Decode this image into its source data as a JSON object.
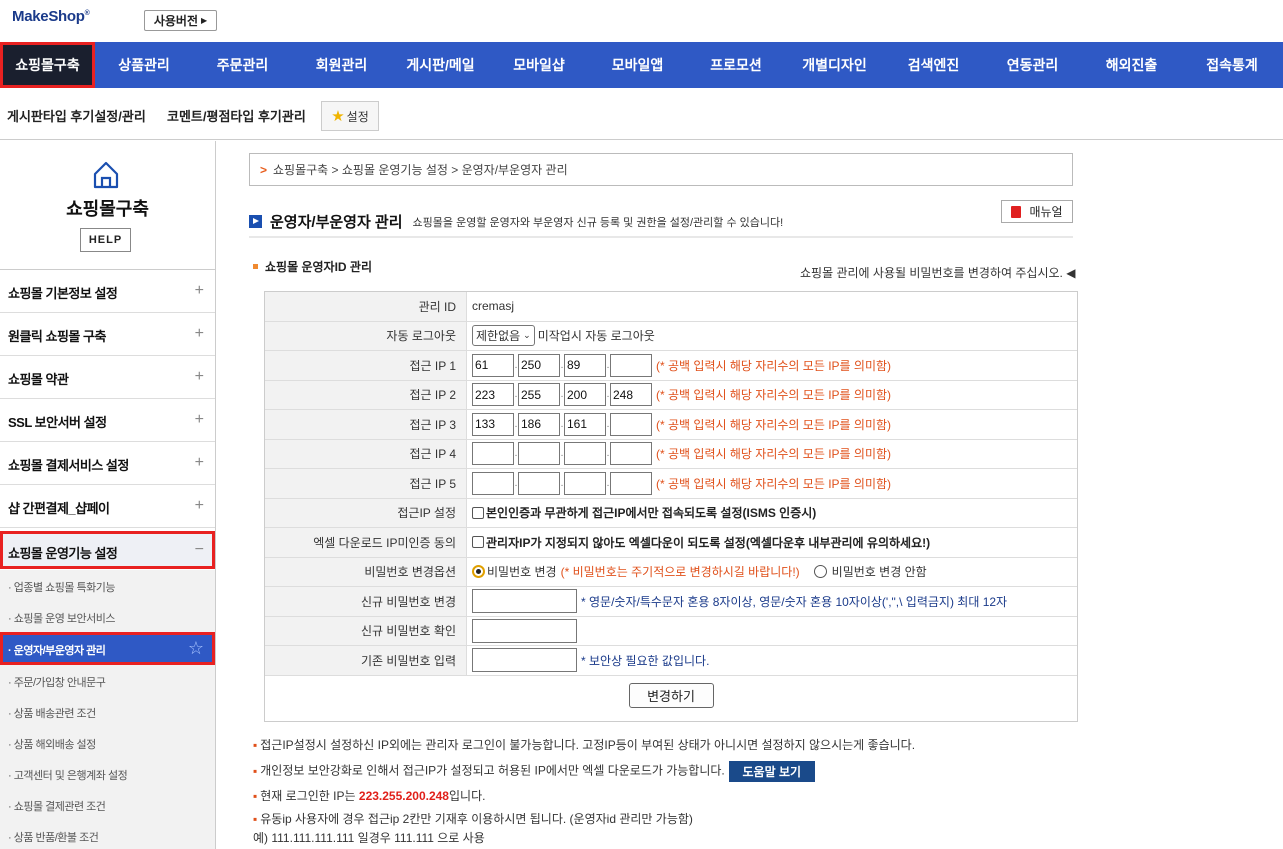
{
  "header": {
    "logo": "MakeShop",
    "logo_mark": "®",
    "version_label": "사용버전"
  },
  "main_nav": [
    {
      "label": "쇼핑몰구축",
      "active": true
    },
    {
      "label": "상품관리"
    },
    {
      "label": "주문관리"
    },
    {
      "label": "회원관리"
    },
    {
      "label": "게시판/메일"
    },
    {
      "label": "모바일샵"
    },
    {
      "label": "모바일앱"
    },
    {
      "label": "프로모션"
    },
    {
      "label": "개별디자인"
    },
    {
      "label": "검색엔진"
    },
    {
      "label": "연동관리"
    },
    {
      "label": "해외진출"
    },
    {
      "label": "접속통계"
    }
  ],
  "sub_nav": {
    "links": [
      "게시판타입 후기설정/관리",
      "코멘트/평점타입 후기관리"
    ],
    "fav_label": "설정"
  },
  "sidebar": {
    "title": "쇼핑몰구축",
    "help_label": "HELP",
    "menus": [
      {
        "label": "쇼핑몰 기본정보 설정",
        "icon": "+"
      },
      {
        "label": "원클릭 쇼핑몰 구축",
        "icon": "+"
      },
      {
        "label": "쇼핑몰 약관",
        "icon": "+"
      },
      {
        "label": "SSL 보안서버 설정",
        "icon": "+"
      },
      {
        "label": "쇼핑몰 결제서비스 설정",
        "icon": "+"
      },
      {
        "label": "샵 간편결제_샵페이",
        "icon": "+"
      },
      {
        "label": "쇼핑몰 운영기능 설정",
        "icon": "−",
        "open": true
      }
    ],
    "sub_items": [
      {
        "label": "· 업종별 쇼핑몰 특화기능"
      },
      {
        "label": "· 쇼핑몰 운영 보안서비스"
      },
      {
        "label": "· 운영자/부운영자 관리",
        "active": true
      },
      {
        "label": "· 주문/가입창 안내문구"
      },
      {
        "label": "· 상품 배송관련 조건"
      },
      {
        "label": "· 상품 해외배송 설정"
      },
      {
        "label": "· 고객센터 및 은행계좌 설정"
      },
      {
        "label": "· 쇼핑몰 결제관련 조건"
      },
      {
        "label": "· 상품 반품/환불 조건"
      }
    ]
  },
  "breadcrumb": "쇼핑몰구축 > 쇼핑몰 운영기능 설정 > 운영자/부운영자 관리",
  "page": {
    "title": "운영자/부운영자 관리",
    "description": "쇼핑몰을 운영할 운영자와 부운영자 신규 등록 및 권한을 설정/관리할 수 있습니다!",
    "manual_label": "매뉴얼",
    "section_title": "쇼핑몰 운영자ID 관리",
    "section_note": "쇼핑몰 관리에 사용될 비밀번호를 변경하여 주십시오. ◀"
  },
  "form": {
    "admin_id_label": "관리 ID",
    "admin_id_value": "cremasj",
    "auto_logout_label": "자동 로그아웃",
    "auto_logout_select": "제한없음",
    "auto_logout_note": "미작업시 자동 로그아웃",
    "ip_note": "(* 공백 입력시 해당 자리수의 모든 IP를 의미함)",
    "ip_rows": [
      {
        "label": "접근 IP 1",
        "values": [
          "61",
          "250",
          "89",
          ""
        ]
      },
      {
        "label": "접근 IP 2",
        "values": [
          "223",
          "255",
          "200",
          "248"
        ]
      },
      {
        "label": "접근 IP 3",
        "values": [
          "133",
          "186",
          "161",
          ""
        ]
      },
      {
        "label": "접근 IP 4",
        "values": [
          "",
          "",
          "",
          ""
        ]
      },
      {
        "label": "접근 IP 5",
        "values": [
          "",
          "",
          "",
          ""
        ]
      }
    ],
    "ip_setting_label": "접근IP 설정",
    "ip_setting_text": "본인인증과 무관하게 접근IP에서만 접속되도록 설정(ISMS 인증시)",
    "excel_label": "엑셀 다운로드 IP미인증 동의",
    "excel_text": "관리자IP가 지정되지 않아도 엑셀다운이 되도록 설정(엑셀다운후 내부관리에 유의하세요!)",
    "pw_option_label": "비밀번호 변경옵션",
    "pw_change_label": "비밀번호 변경",
    "pw_change_note": "(* 비밀번호는 주기적으로 변경하시길 바랍니다!)",
    "pw_nochange_label": "비밀번호 변경 안함",
    "new_pw_label": "신규 비밀번호 변경",
    "new_pw_note": "* 영문/숫자/특수문자 혼용 8자이상, 영문/숫자 혼용 10자이상(',\",\\ 입력금지) 최대 12자",
    "confirm_pw_label": "신규 비밀번호 확인",
    "old_pw_label": "기존 비밀번호 입력",
    "old_pw_note": "* 보안상 필요한 값입니다.",
    "submit_label": "변경하기"
  },
  "notes": {
    "note1": "접근IP설정시 설정하신 IP외에는 관리자 로그인이 불가능합니다. 고정IP등이 부여된 상태가 아니시면 설정하지 않으시는게 좋습니다.",
    "note2": "개인정보 보안강화로 인해서 접근IP가 설정되고 허용된 IP에서만 엑셀 다운로드가 가능합니다.",
    "help_view_label": "도움말 보기",
    "note3_prefix": "현재 로그인한 IP는 ",
    "current_ip": "223.255.200.248",
    "note3_suffix": "입니다.",
    "note4": "유동ip 사용자에 경우 접근ip 2칸만 기재후 이용하시면 됩니다. (운영자id 관리만 가능함)",
    "note5": "예) 111.111.111.111 일경우 111.111 으로 사용"
  }
}
